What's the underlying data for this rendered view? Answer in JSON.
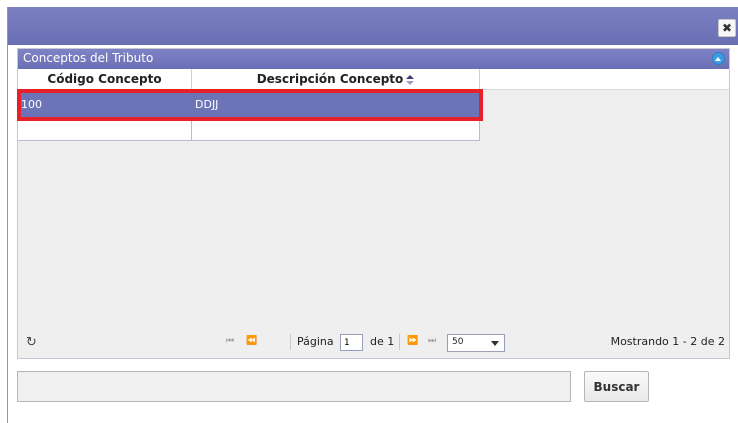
{
  "dialog": {
    "close_label": "✖"
  },
  "panel": {
    "title": "Conceptos del Tributo"
  },
  "grid": {
    "columns": [
      "Código Concepto",
      "Descripción Concepto"
    ],
    "rows": [
      {
        "code": "100",
        "description": "DDJJ",
        "selected": true
      },
      {
        "code": "",
        "description": "",
        "selected": false
      }
    ]
  },
  "pager": {
    "refresh_icon": "↻",
    "first_icon": "⏮",
    "prev_icon": "⏪",
    "next_icon": "⏩",
    "last_icon": "⏭",
    "page_label": "Página",
    "page_value": "1",
    "of_label": "de 1",
    "rows_per_page": "50",
    "showing_text": "Mostrando 1 - 2 de 2"
  },
  "search": {
    "value": "",
    "button_label": "Buscar"
  },
  "colors": {
    "accent": "#6d73b7",
    "highlight": "#e8202a",
    "collapse": "#3d9be3"
  }
}
